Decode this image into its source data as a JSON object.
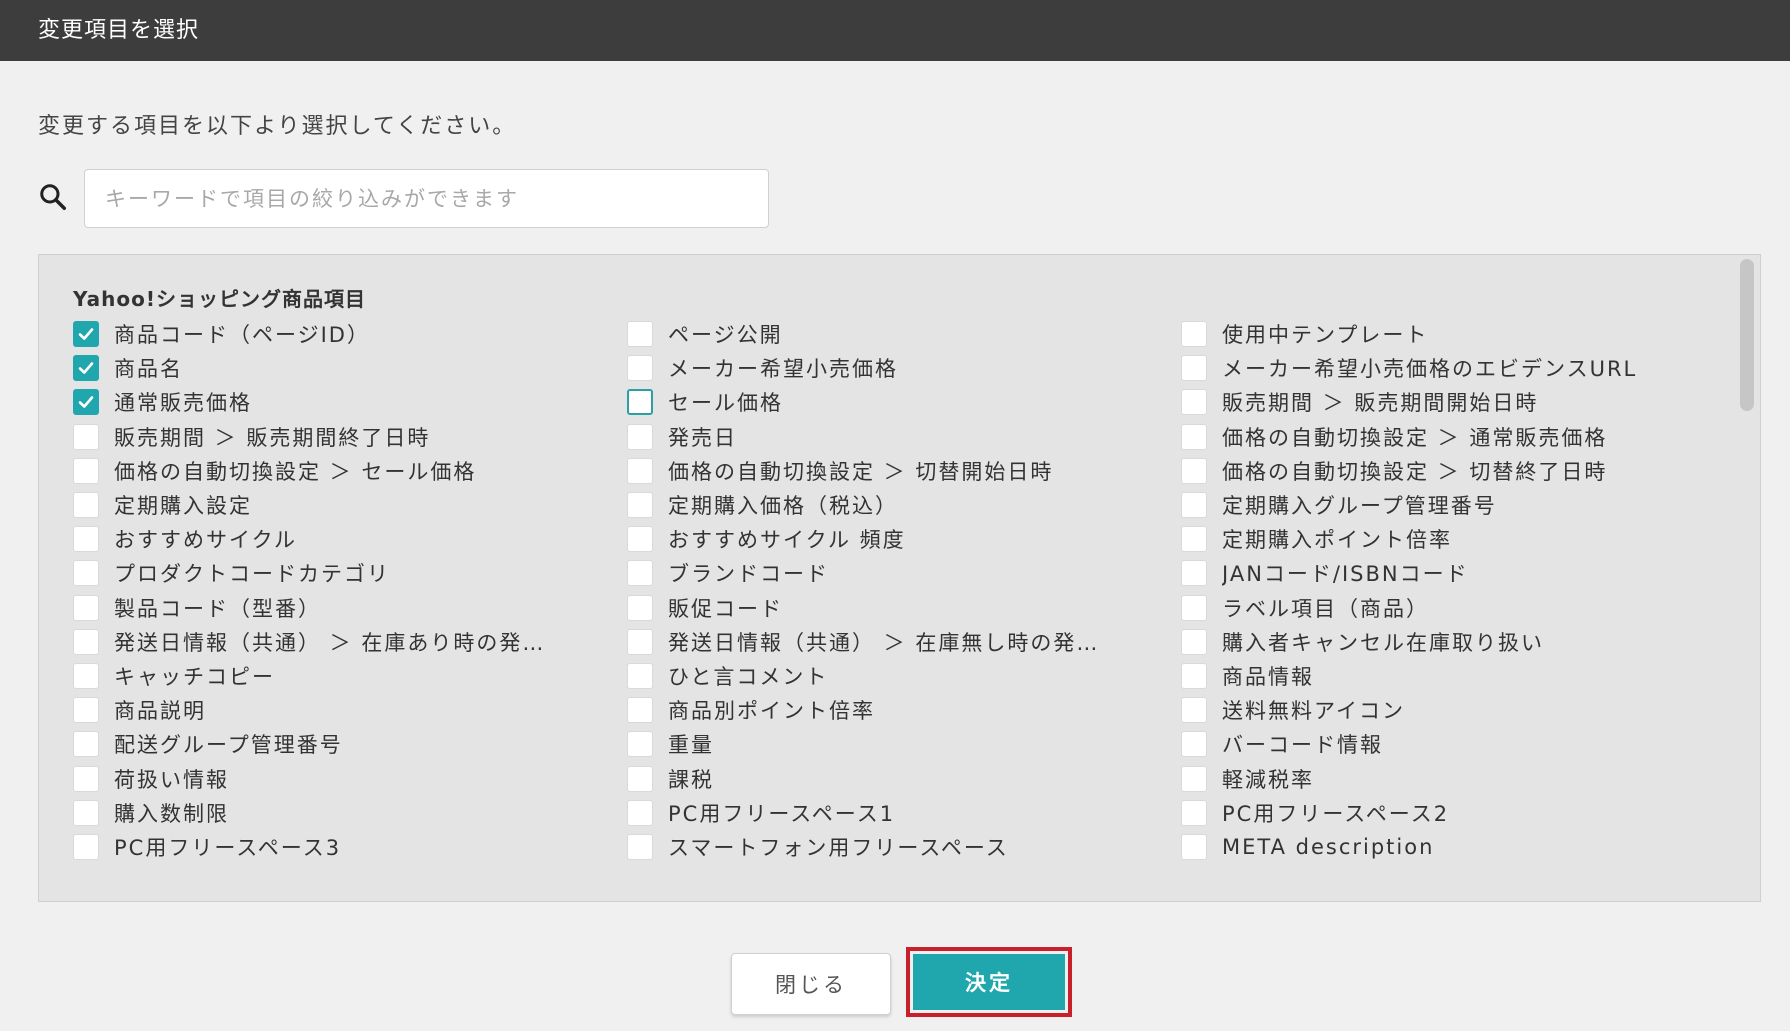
{
  "dialog": {
    "title": "変更項目を選択",
    "description": "変更する項目を以下より選択してください。"
  },
  "search": {
    "icon": "search-icon",
    "placeholder": "キーワードで項目の絞り込みができます",
    "value": ""
  },
  "group": {
    "title": "Yahoo!ショッピング商品項目"
  },
  "items": [
    {
      "label": "商品コード（ページID）",
      "checked": true
    },
    {
      "label": "ページ公開",
      "checked": false
    },
    {
      "label": "使用中テンプレート",
      "checked": false
    },
    {
      "label": "商品名",
      "checked": true
    },
    {
      "label": "メーカー希望小売価格",
      "checked": false
    },
    {
      "label": "メーカー希望小売価格のエビデンスURL",
      "checked": false
    },
    {
      "label": "通常販売価格",
      "checked": true
    },
    {
      "label": "セール価格",
      "checked": false,
      "focused": true
    },
    {
      "label": "販売期間 ＞ 販売期間開始日時",
      "checked": false
    },
    {
      "label": "販売期間 ＞ 販売期間終了日時",
      "checked": false
    },
    {
      "label": "発売日",
      "checked": false
    },
    {
      "label": "価格の自動切換設定 ＞ 通常販売価格",
      "checked": false
    },
    {
      "label": "価格の自動切換設定 ＞ セール価格",
      "checked": false
    },
    {
      "label": "価格の自動切換設定 ＞ 切替開始日時",
      "checked": false
    },
    {
      "label": "価格の自動切換設定 ＞ 切替終了日時",
      "checked": false
    },
    {
      "label": "定期購入設定",
      "checked": false
    },
    {
      "label": "定期購入価格（税込）",
      "checked": false
    },
    {
      "label": "定期購入グループ管理番号",
      "checked": false
    },
    {
      "label": "おすすめサイクル",
      "checked": false
    },
    {
      "label": "おすすめサイクル 頻度",
      "checked": false
    },
    {
      "label": "定期購入ポイント倍率",
      "checked": false
    },
    {
      "label": "プロダクトコードカテゴリ",
      "checked": false
    },
    {
      "label": "ブランドコード",
      "checked": false
    },
    {
      "label": "JANコード/ISBNコード",
      "checked": false
    },
    {
      "label": "製品コード（型番）",
      "checked": false
    },
    {
      "label": "販促コード",
      "checked": false
    },
    {
      "label": "ラベル項目（商品）",
      "checked": false
    },
    {
      "label": "発送日情報（共通） ＞ 在庫あり時の発…",
      "checked": false
    },
    {
      "label": "発送日情報（共通） ＞ 在庫無し時の発…",
      "checked": false
    },
    {
      "label": "購入者キャンセル在庫取り扱い",
      "checked": false
    },
    {
      "label": "キャッチコピー",
      "checked": false
    },
    {
      "label": "ひと言コメント",
      "checked": false
    },
    {
      "label": "商品情報",
      "checked": false
    },
    {
      "label": "商品説明",
      "checked": false
    },
    {
      "label": "商品別ポイント倍率",
      "checked": false
    },
    {
      "label": "送料無料アイコン",
      "checked": false
    },
    {
      "label": "配送グループ管理番号",
      "checked": false
    },
    {
      "label": "重量",
      "checked": false
    },
    {
      "label": "バーコード情報",
      "checked": false
    },
    {
      "label": "荷扱い情報",
      "checked": false
    },
    {
      "label": "課税",
      "checked": false
    },
    {
      "label": "軽減税率",
      "checked": false
    },
    {
      "label": "購入数制限",
      "checked": false
    },
    {
      "label": "PC用フリースペース1",
      "checked": false
    },
    {
      "label": "PC用フリースペース2",
      "checked": false
    },
    {
      "label": "PC用フリースペース3",
      "checked": false
    },
    {
      "label": "スマートフォン用フリースペース",
      "checked": false
    },
    {
      "label": "META description",
      "checked": false
    }
  ],
  "buttons": {
    "close_label": "閉じる",
    "ok_label": "決定"
  },
  "colors": {
    "accent": "#20a7ad",
    "titlebar": "#3d3d3d",
    "highlight_border": "#c8202a"
  }
}
